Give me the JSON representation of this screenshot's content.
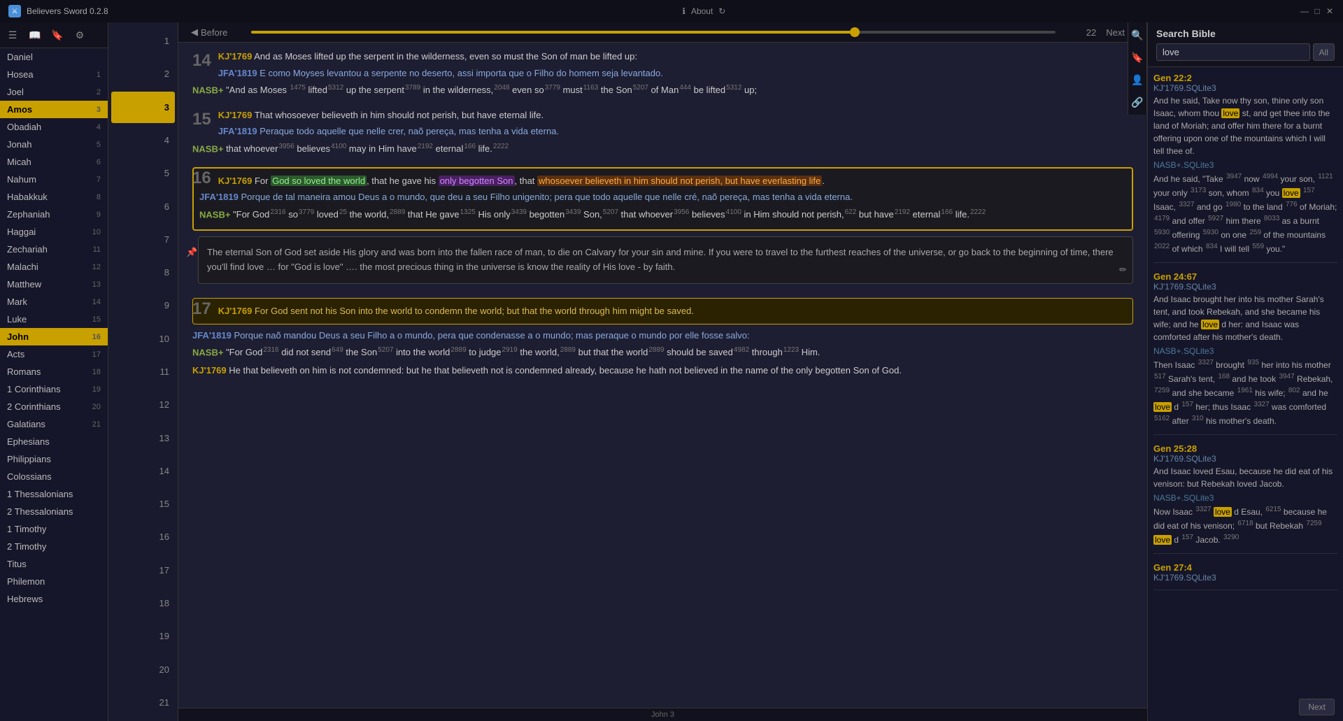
{
  "app": {
    "title": "Believers Sword 0.2.8",
    "icon": "⚔"
  },
  "titlebar": {
    "about_label": "About",
    "win_controls": [
      "—",
      "□",
      "✕"
    ]
  },
  "sidebar": {
    "books": [
      {
        "name": "Daniel",
        "num": "",
        "active": false
      },
      {
        "name": "Hosea",
        "num": "1",
        "active": false
      },
      {
        "name": "Joel",
        "num": "2",
        "active": false
      },
      {
        "name": "Amos",
        "num": "3",
        "active": true
      },
      {
        "name": "Obadiah",
        "num": "4",
        "active": false
      },
      {
        "name": "Jonah",
        "num": "5",
        "active": false
      },
      {
        "name": "Micah",
        "num": "6",
        "active": false
      },
      {
        "name": "Nahum",
        "num": "7",
        "active": false
      },
      {
        "name": "Habakkuk",
        "num": "8",
        "active": false
      },
      {
        "name": "Zephaniah",
        "num": "9",
        "active": false
      },
      {
        "name": "Haggai",
        "num": "10",
        "active": false
      },
      {
        "name": "Zechariah",
        "num": "11",
        "active": false
      },
      {
        "name": "Malachi",
        "num": "12",
        "active": false
      },
      {
        "name": "Matthew",
        "num": "13",
        "active": false
      },
      {
        "name": "Mark",
        "num": "14",
        "active": false
      },
      {
        "name": "Luke",
        "num": "15",
        "active": false
      },
      {
        "name": "John",
        "num": "16",
        "active": true
      },
      {
        "name": "Acts",
        "num": "17",
        "active": false
      },
      {
        "name": "Romans",
        "num": "18",
        "active": false
      },
      {
        "name": "1 Corinthians",
        "num": "19",
        "active": false
      },
      {
        "name": "2 Corinthians",
        "num": "20",
        "active": false
      },
      {
        "name": "Galatians",
        "num": "21",
        "active": false
      },
      {
        "name": "Ephesians",
        "num": "",
        "active": false
      },
      {
        "name": "Philippians",
        "num": "",
        "active": false
      },
      {
        "name": "Colossians",
        "num": "",
        "active": false
      },
      {
        "name": "1 Thessalonians",
        "num": "",
        "active": false
      },
      {
        "name": "2 Thessalonians",
        "num": "",
        "active": false
      },
      {
        "name": "1 Timothy",
        "num": "",
        "active": false
      },
      {
        "name": "2 Timothy",
        "num": "",
        "active": false
      },
      {
        "name": "Titus",
        "num": "",
        "active": false
      },
      {
        "name": "Philemon",
        "num": "",
        "active": false
      },
      {
        "name": "Hebrews",
        "num": "",
        "active": false
      }
    ]
  },
  "chapters": [
    1,
    2,
    3,
    4,
    5,
    6,
    7,
    8,
    9,
    10,
    11,
    12,
    13,
    14,
    15,
    16,
    17,
    18,
    19,
    20,
    21
  ],
  "active_chapter": 3,
  "nav": {
    "before": "Before",
    "next": "Next",
    "slider_value": "22"
  },
  "verses": {
    "v14": {
      "num": "14",
      "kj": "KJ'1769",
      "kj_text": "And as Moses lifted up the serpent in the wilderness, even so must the Son of man be lifted up:",
      "jfa": "JFA'1819",
      "jfa_text": "E como Moyses levantou a serpente no deserto, assi importa que o Filho do homem seja levantado.",
      "nasb": "NASB+",
      "nasb_text": "\"And as Moses lifted up the serpent in the wilderness, even so must the Son of Man be lifted up;"
    },
    "v15": {
      "num": "15",
      "kj": "KJ'1769",
      "kj_text": "That whosoever believeth in him should not perish, but have eternal life.",
      "jfa": "JFA'1819",
      "jfa_text": "Peraque todo aquelle que nelle crer, naõ pereça, mas tenha a vida eterna.",
      "nasb": "NASB+",
      "nasb_text": "that whoever believes may in Him have eternal life."
    },
    "v16": {
      "num": "16",
      "kj": "KJ'1769",
      "kj_text_pre": "For ",
      "kj_highlight1": "God so loved the world",
      "kj_text_mid1": ", that he gave his ",
      "kj_highlight2": "only begotten Son",
      "kj_text_mid2": ", that ",
      "kj_highlight3": "whosoever believeth in him should not perish, but have everlasting life",
      "kj_text_end": ".",
      "jfa": "JFA'1819",
      "jfa_text": "Porque de tal maneira amou Deus a o mundo, que deu a seu Filho unigenito; pera que todo aquelle que nelle cré, naõ pereça, mas tenha a vida eterna.",
      "nasb": "NASB+",
      "nasb_text": "\"For God so loved the world, that He gave His only begotten Son, that whoever believes in Him should not perish, but have eternal life.",
      "note": "The eternal Son of God set aside His glory and was born into the fallen race of man, to die on Calvary for your sin and mine. If you were to travel to the furthest reaches of the universe, or go back to the beginning of time, there you'll find love … for \"God is love\" …. the most precious thing in the universe is know the reality of His love - by faith."
    },
    "v17": {
      "num": "17",
      "kj": "KJ'1769",
      "kj_text": "For God sent not his Son into the world to condemn the world; but that the world through him might be saved.",
      "jfa": "JFA'1819",
      "jfa_text": "Porque naõ mandou Deus a seu Filho a o mundo, pera que condenasse a o mundo; mas peraque o mundo por elle fosse salvo:",
      "nasb": "NASB+",
      "nasb_text": "\"For God did not send the Son into the world to judge the world, but that the world should be saved through Him.",
      "kj2": "KJ'1769",
      "kj2_text": "He that believeth on him is not condemned: but he that believeth not is condemned already, because he hath not believed in the name of the only begotten Son of God."
    }
  },
  "footer": {
    "label": "John 3"
  },
  "search": {
    "title": "Search Bible",
    "query": "love",
    "scope": "All",
    "results": [
      {
        "ref": "Gen 22:2",
        "version1": "KJ'1769.SQLite3",
        "text1": "And he said, Take now thy son, thine only son Isaac, whom thou love st, and get thee into the land of Moriah; and offer him there for a burnt offering upon one of the mountains which I will tell thee of.",
        "version2": "NASB+.SQLite3",
        "text2": "And he said, \"Take 3947 now 4994 your son, 1121 your only 3173 son, whom 834 you love 157 Isaac, 3327 and go 1980 to the land 776 of Moriah; 4179 and offer 5927 him there 8033 as a burnt 5930 offering 5930 on one 259 of the mountains 2022 of which 834 I will tell 559 you.\""
      },
      {
        "ref": "Gen 24:67",
        "version1": "KJ'1769.SQLite3",
        "text1": "And Isaac brought her into his mother Sarah's tent, and took Rebekah, and she became his wife; and he love d her: and Isaac was comforted after his mother's death.",
        "version2": "NASB+.SQLite3",
        "text2": "Then Isaac 3327 brought 935 her into his mother 517 Sarah's tent, 168 and he took 3947 Rebekah, 7259 and she became 1961 his wife; 802 and he love d 157 her; thus Isaac 3327 was comforted 5162 after 310 his mother's death."
      },
      {
        "ref": "Gen 25:28",
        "version1": "KJ'1769.SQLite3",
        "text1": "And Isaac loved Esau, because he did eat of his venison: but Rebekah loved Jacob.",
        "version2": "NASB+.SQLite3",
        "text2": "Now Isaac 3327 love d Esau, 6215 because he did eat of his venison; 6718 but Rebekah 7259 love d 157 Jacob. 3290"
      },
      {
        "ref": "Gen 27:4",
        "version1": "KJ'1769.SQLite3",
        "text1": "",
        "version2": "",
        "text2": ""
      }
    ],
    "next_btn": "Next"
  }
}
